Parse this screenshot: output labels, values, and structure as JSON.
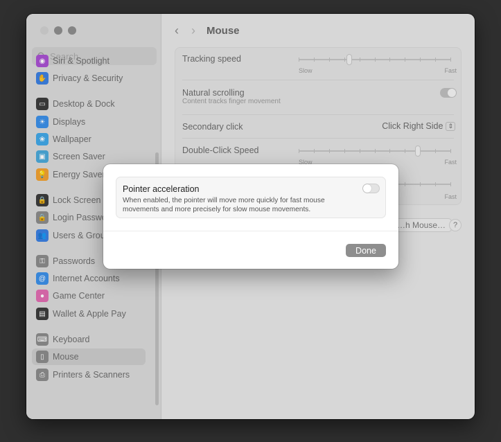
{
  "window": {
    "traffic_lights": [
      "close",
      "minimize",
      "zoom"
    ]
  },
  "sidebar": {
    "search_placeholder": "Search",
    "items": [
      {
        "label": "Siri & Spotlight",
        "icon": "siri-icon",
        "color": "#a84fd1"
      },
      {
        "label": "Privacy & Security",
        "icon": "hand-icon",
        "color": "#3a7ee0"
      },
      {
        "label": "Desktop & Dock",
        "icon": "dock-icon",
        "color": "#3a3a3a"
      },
      {
        "label": "Displays",
        "icon": "sun-icon",
        "color": "#3a8fe8"
      },
      {
        "label": "Wallpaper",
        "icon": "flower-icon",
        "color": "#3fa6e6"
      },
      {
        "label": "Screen Saver",
        "icon": "screen-saver-icon",
        "color": "#49a8d8"
      },
      {
        "label": "Energy Saver",
        "icon": "bulb-icon",
        "color": "#f0a030"
      },
      {
        "label": "Lock Screen",
        "icon": "lock-icon",
        "color": "#3a3a3a"
      },
      {
        "label": "Login Password",
        "icon": "login-lock-icon",
        "color": "#8a8a8a"
      },
      {
        "label": "Users & Groups",
        "icon": "users-icon",
        "color": "#3a7ee0"
      },
      {
        "label": "Passwords",
        "icon": "key-icon",
        "color": "#8a8a8a"
      },
      {
        "label": "Internet Accounts",
        "icon": "at-icon",
        "color": "#3a8fe8"
      },
      {
        "label": "Game Center",
        "icon": "game-center-icon",
        "color": "#e06bb0"
      },
      {
        "label": "Wallet & Apple Pay",
        "icon": "wallet-icon",
        "color": "#3a3a3a"
      },
      {
        "label": "Keyboard",
        "icon": "keyboard-icon",
        "color": "#8a8a8a"
      },
      {
        "label": "Mouse",
        "icon": "mouse-icon",
        "color": "#8a8a8a"
      },
      {
        "label": "Printers & Scanners",
        "icon": "printer-icon",
        "color": "#8a8a8a"
      }
    ]
  },
  "main": {
    "title": "Mouse",
    "back_glyph": "‹",
    "forward_glyph": "›",
    "tracking_speed": {
      "label": "Tracking speed",
      "min": "Slow",
      "max": "Fast",
      "value": 0.33
    },
    "natural_scrolling": {
      "label": "Natural scrolling",
      "desc": "Content tracks finger movement",
      "on": true
    },
    "secondary_click": {
      "label": "Secondary click",
      "value": "Click Right Side"
    },
    "double_click_speed": {
      "label": "Double-Click Speed",
      "min": "Slow",
      "max": "Fast",
      "value": 0.78
    },
    "scrolling_speed": {
      "max": "Fast"
    },
    "pair_button": "…h Mouse…",
    "help": "?"
  },
  "modal": {
    "title": "Pointer acceleration",
    "description": "When enabled, the pointer will move more quickly for fast mouse movements and more precisely for slow mouse movements.",
    "toggle_on": false,
    "done_label": "Done"
  }
}
